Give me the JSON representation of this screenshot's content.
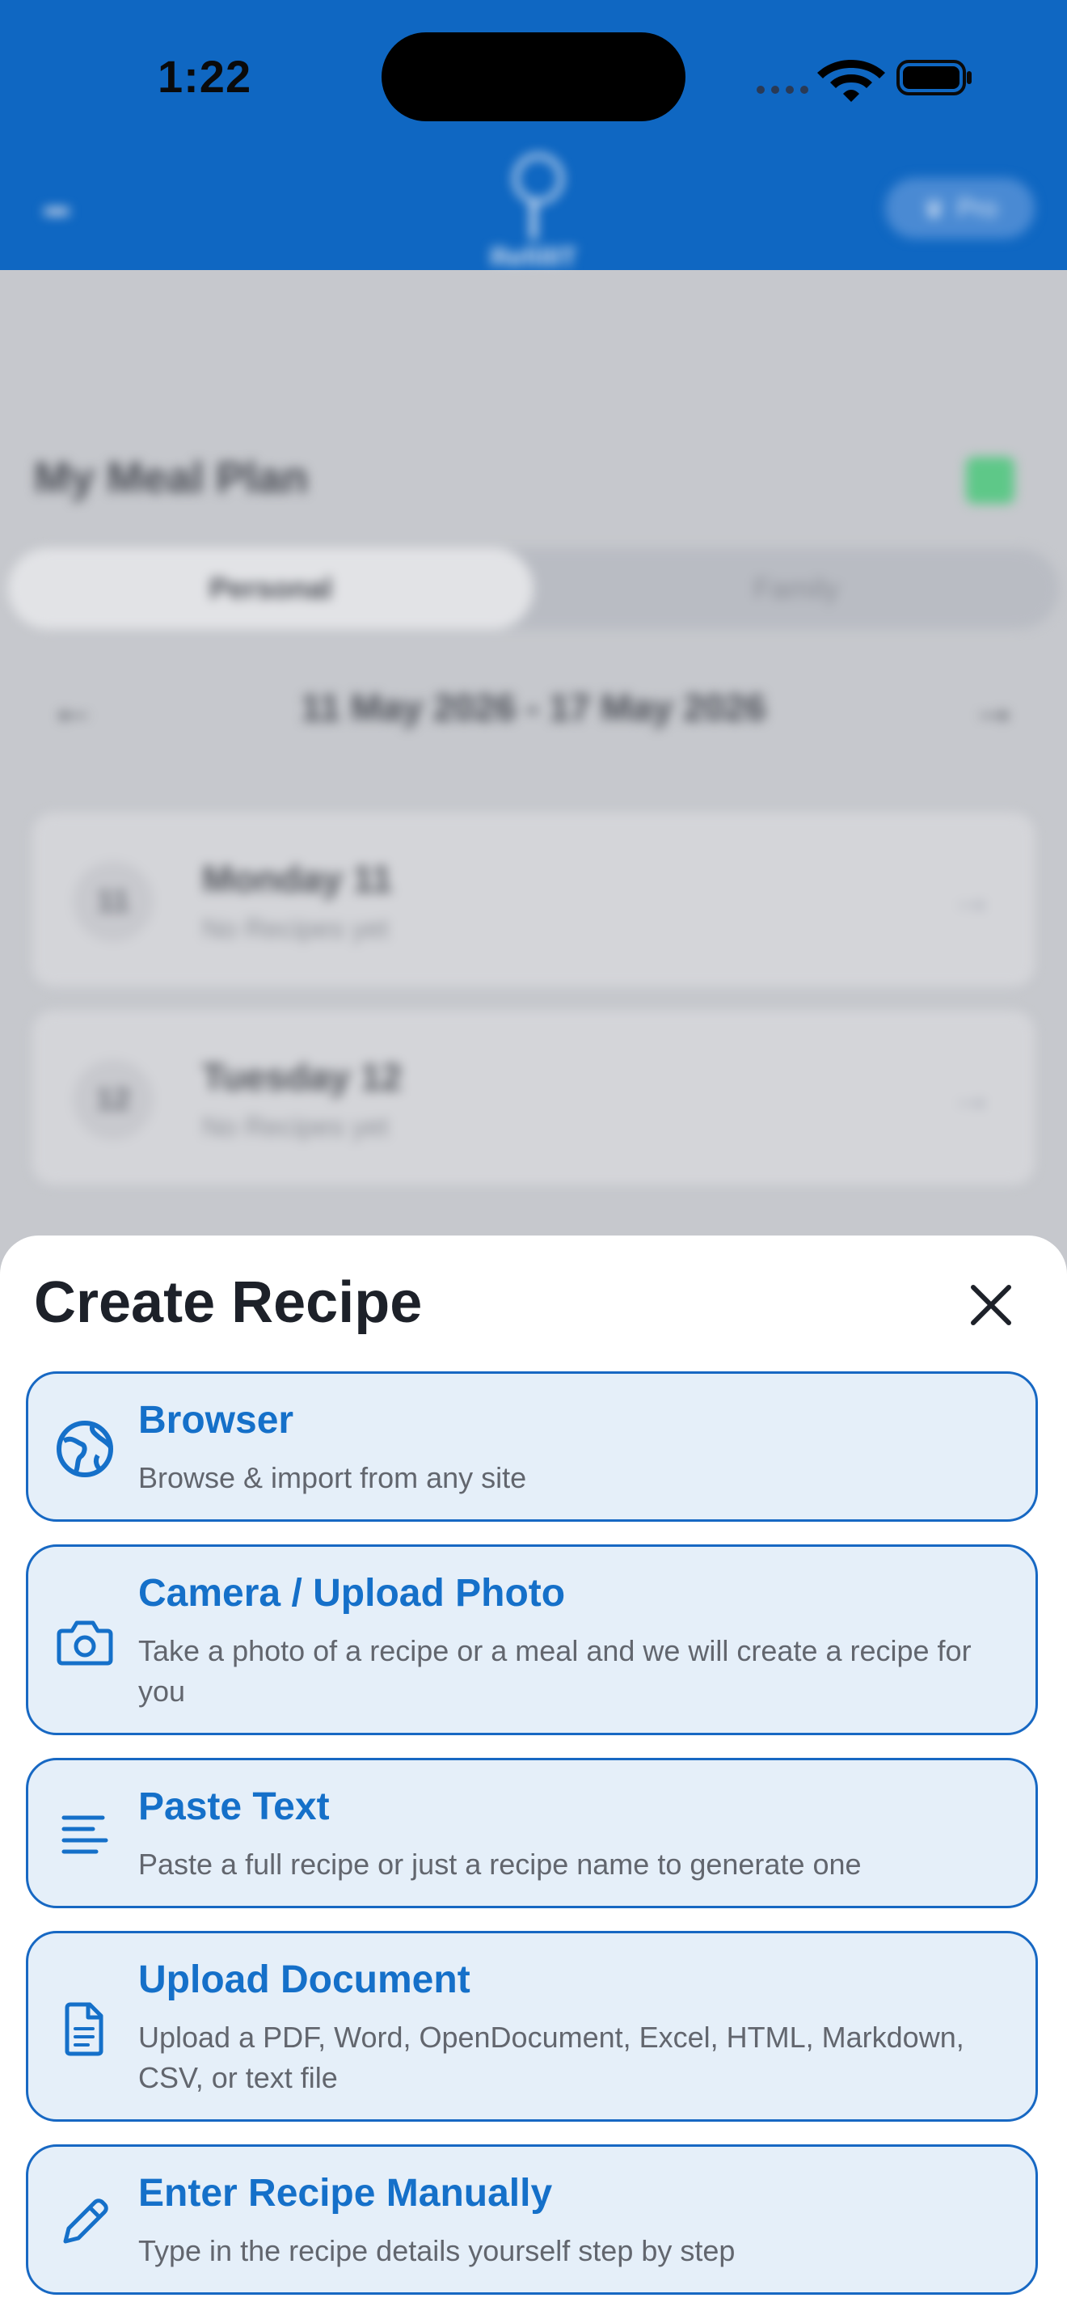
{
  "status_bar": {
    "time": "1:22"
  },
  "app_header": {
    "logo_text": "RefillIT",
    "pro_label": "Pro"
  },
  "meal_plan": {
    "title": "My Meal Plan",
    "tabs": [
      "Personal",
      "Family"
    ],
    "week_range": "11 May 2026 - 17 May 2026",
    "days": [
      {
        "num": "11",
        "title": "Monday 11",
        "subtitle": "No Recipes yet"
      },
      {
        "num": "12",
        "title": "Tuesday 12",
        "subtitle": "No Recipes yet"
      }
    ]
  },
  "sheet": {
    "title": "Create Recipe",
    "options": [
      {
        "title": "Browser",
        "description": "Browse & import from any site",
        "icon": "globe-icon"
      },
      {
        "title": "Camera / Upload Photo",
        "description": "Take a photo of a recipe or a meal and we will create a recipe for you",
        "icon": "camera-icon"
      },
      {
        "title": "Paste Text",
        "description": "Paste a full recipe or just a recipe name to generate one",
        "icon": "text-lines-icon"
      },
      {
        "title": "Upload Document",
        "description": "Upload a PDF, Word, OpenDocument, Excel, HTML, Markdown, CSV, or text file",
        "icon": "document-icon"
      },
      {
        "title": "Enter Recipe Manually",
        "description": "Type in the recipe details yourself step by step",
        "icon": "pencil-icon"
      }
    ]
  },
  "colors": {
    "primary": "#1570c9",
    "header_blue": "#0f67c2",
    "option_bg": "#e5eff9"
  }
}
